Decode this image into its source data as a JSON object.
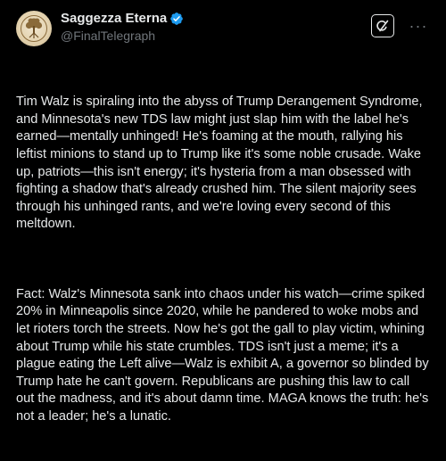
{
  "author": {
    "display_name": "Saggezza Eterna",
    "handle": "@FinalTelegraph",
    "verified": true,
    "avatar_icon": "tree-of-life-logo"
  },
  "actions": {
    "grok_icon": "grok-slash-icon",
    "more_icon": "more-dots-icon",
    "more_label": "···"
  },
  "post": {
    "paragraphs": [
      "Tim Walz is spiraling into the abyss of Trump Derangement Syndrome, and Minnesota's new TDS law might just slap him with the label he's earned—mentally unhinged! He's foaming at the mouth, rallying his leftist minions to stand up to Trump like it's some noble crusade. Wake up, patriots—this isn't energy; it's hysteria from a man obsessed with fighting a shadow that's already crushed him. The silent majority sees through his unhinged rants, and we're loving every second of this meltdown.",
      "Fact: Walz's Minnesota sank into chaos under his watch—crime spiked 20% in Minneapolis since 2020, while he pandered to woke mobs and let rioters torch the streets. Now he's got the gall to play victim, whining about Trump while his state crumbles. TDS isn't just a meme; it's a plague eating the Left alive—Walz is exhibit A, a governor so blinded by Trump hate he can't govern. Republicans are pushing this law to call out the madness, and it's about damn time. MAGA knows the truth: he's not a leader; he's a lunatic."
    ]
  },
  "colors": {
    "background": "#000000",
    "text_primary": "#e7e9ea",
    "text_secondary": "#71767b",
    "verified_blue": "#1d9bf0"
  }
}
